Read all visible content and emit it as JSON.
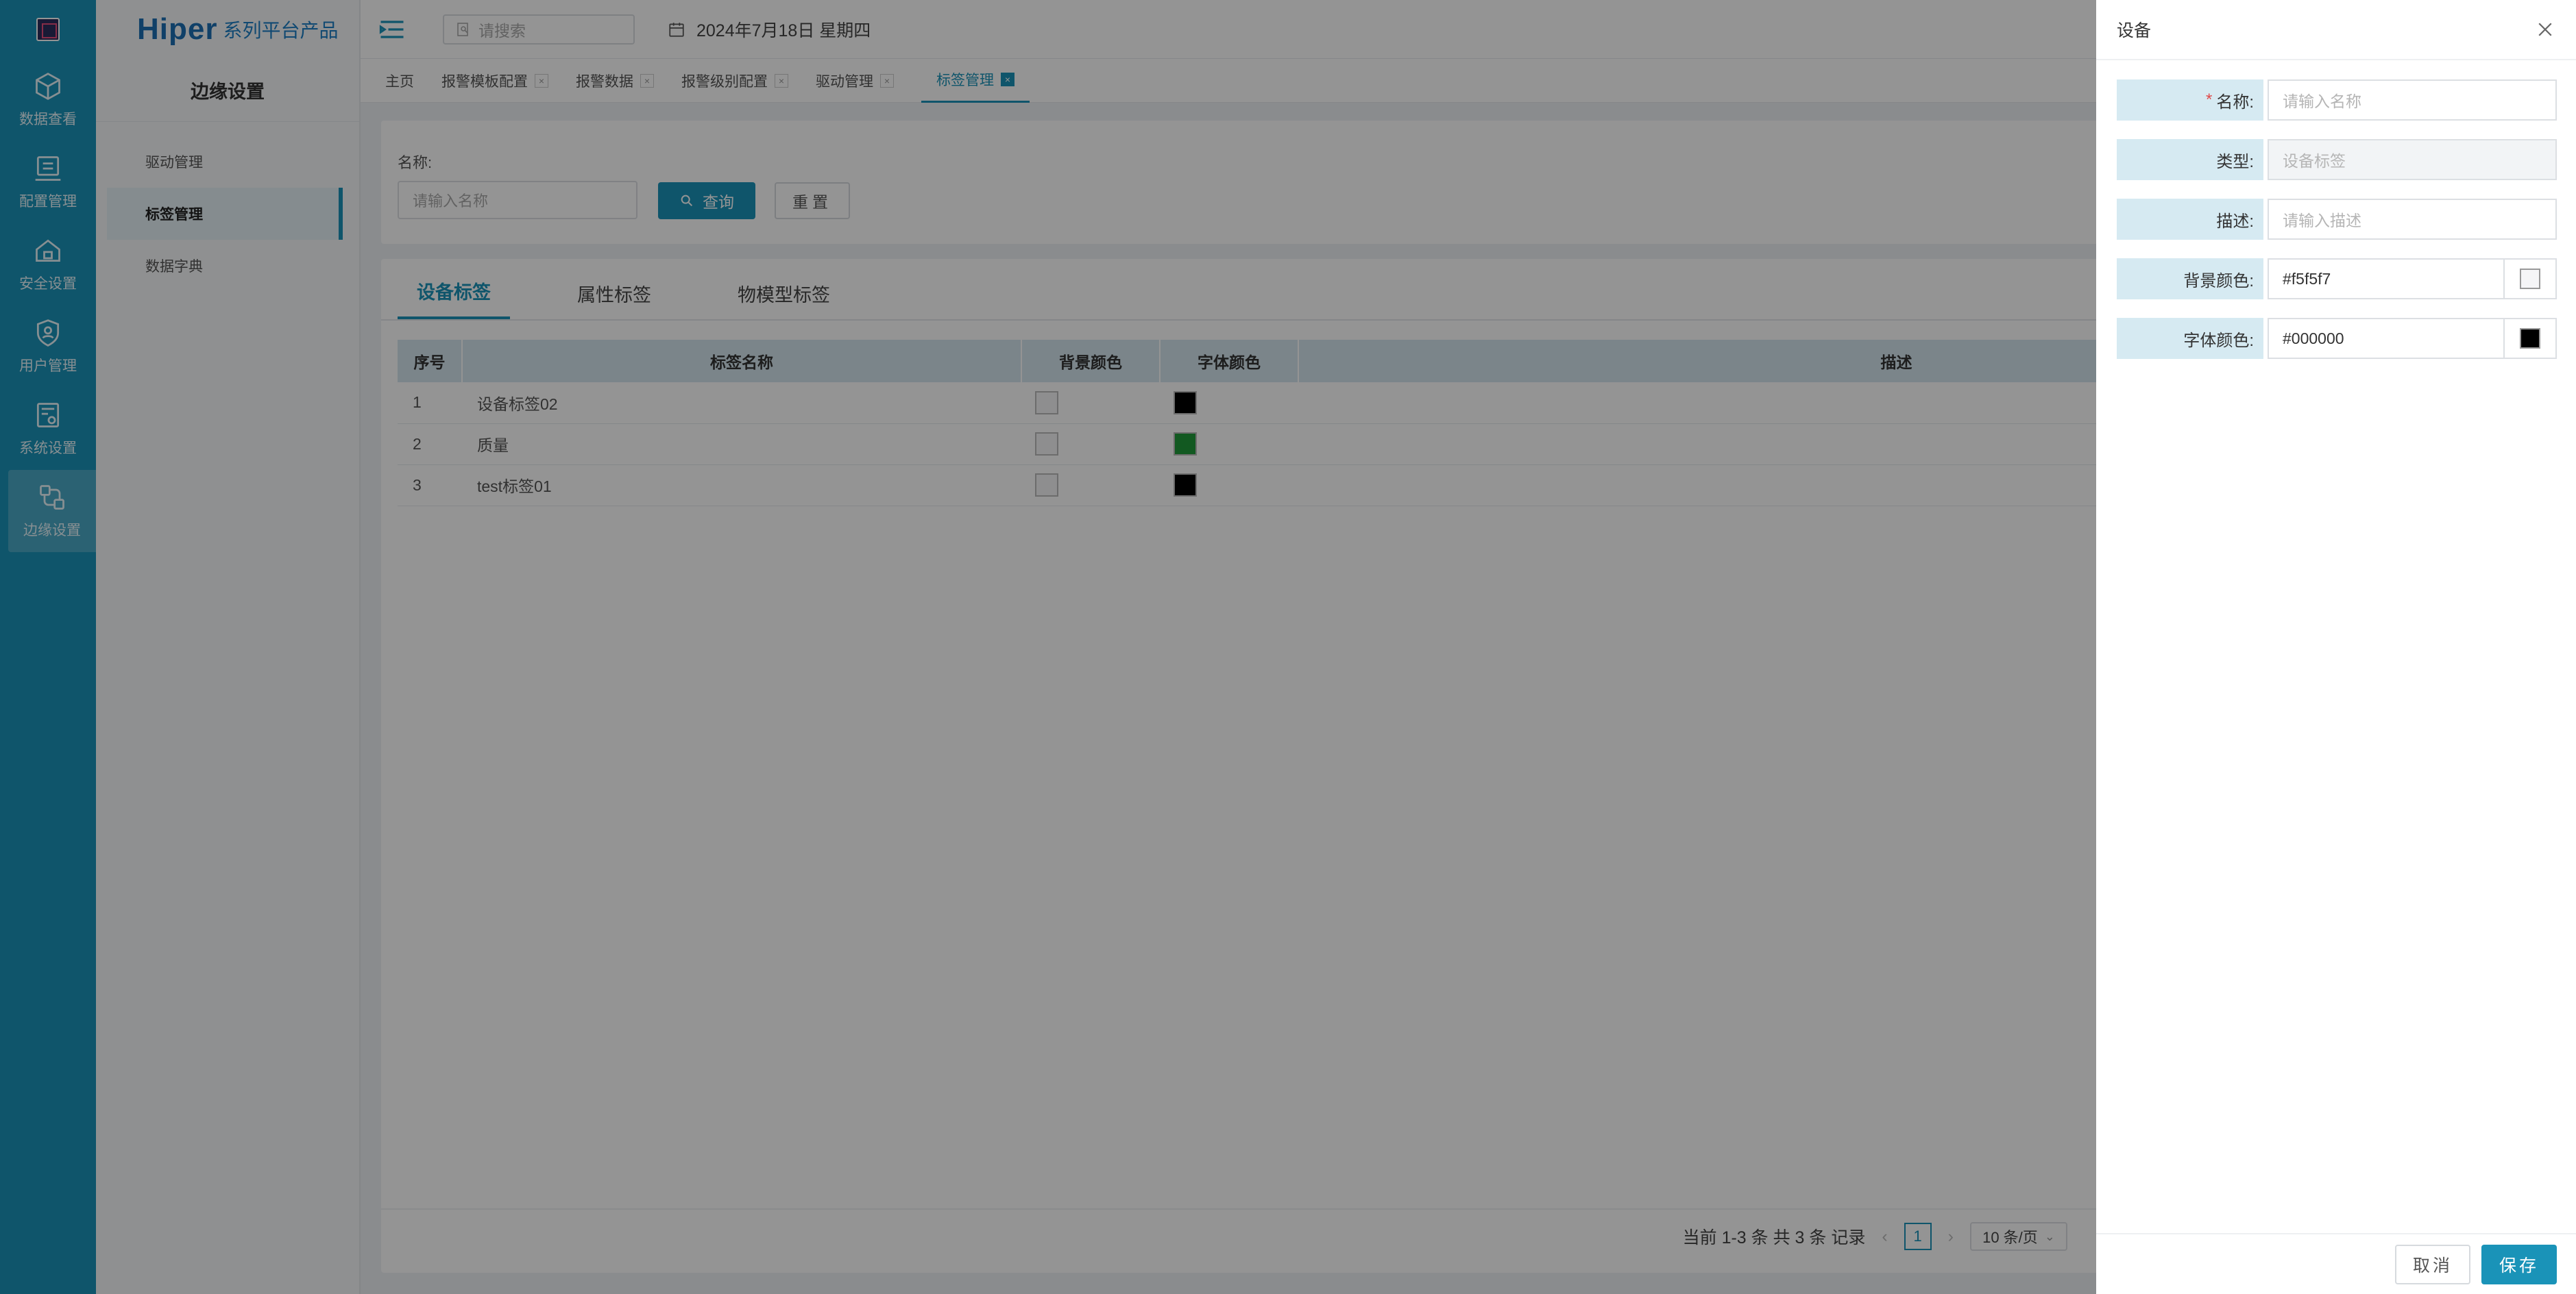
{
  "brand": {
    "name": "Hiper",
    "subtitle": "系列平台产品"
  },
  "rail": [
    {
      "label": "数据查看",
      "icon": "cube-icon"
    },
    {
      "label": "配置管理",
      "icon": "config-icon"
    },
    {
      "label": "安全设置",
      "icon": "security-icon"
    },
    {
      "label": "用户管理",
      "icon": "user-shield-icon"
    },
    {
      "label": "系统设置",
      "icon": "system-icon"
    },
    {
      "label": "边缘设置",
      "icon": "edge-icon",
      "active": true
    }
  ],
  "sidebar": {
    "title": "边缘设置",
    "items": [
      {
        "label": "驱动管理"
      },
      {
        "label": "标签管理",
        "active": true
      },
      {
        "label": "数据字典"
      }
    ]
  },
  "topbar": {
    "search_placeholder": "请搜索",
    "date": "2024年7月18日 星期四"
  },
  "tabs": [
    {
      "label": "主页",
      "closable": false
    },
    {
      "label": "报警模板配置",
      "closable": true
    },
    {
      "label": "报警数据",
      "closable": true
    },
    {
      "label": "报警级别配置",
      "closable": true
    },
    {
      "label": "驱动管理",
      "closable": true
    },
    {
      "label": "标签管理",
      "closable": true,
      "active": true
    }
  ],
  "query": {
    "name_label": "名称:",
    "name_placeholder": "请输入名称",
    "search_button": "查询",
    "reset_button": "重置"
  },
  "panel_tabs": [
    {
      "label": "设备标签",
      "active": true
    },
    {
      "label": "属性标签"
    },
    {
      "label": "物模型标签"
    }
  ],
  "table": {
    "columns": [
      "序号",
      "标签名称",
      "背景颜色",
      "字体颜色",
      "描述"
    ],
    "rows": [
      {
        "no": "1",
        "name": "设备标签02",
        "bg": "#f5f5f7",
        "fg": "#000000",
        "desc": ""
      },
      {
        "no": "2",
        "name": "质量",
        "bg": "#f5f5f7",
        "fg": "#1f9a3a",
        "desc": ""
      },
      {
        "no": "3",
        "name": "test标签01",
        "bg": "#f5f5f7",
        "fg": "#000000",
        "desc": ""
      }
    ]
  },
  "pager": {
    "summary": "当前 1-3 条 共 3 条 记录",
    "page": "1",
    "page_size": "10 条/页"
  },
  "drawer": {
    "title": "设备",
    "fields": [
      {
        "label": "名称:",
        "required": true,
        "placeholder": "请输入名称",
        "value": ""
      },
      {
        "label": "类型:",
        "required": false,
        "placeholder": "设备标签",
        "value": "",
        "disabled": true
      },
      {
        "label": "描述:",
        "required": false,
        "placeholder": "请输入描述",
        "value": ""
      },
      {
        "label": "背景颜色:",
        "required": false,
        "value": "#f5f5f7",
        "swatch": "#f5f5f7"
      },
      {
        "label": "字体颜色:",
        "required": false,
        "value": "#000000",
        "swatch": "#000000"
      }
    ],
    "cancel": "取消",
    "save": "保存"
  },
  "colors": {
    "primary": "#1a93b8",
    "rail": "#1a93b8",
    "header_row": "#d4e6ee",
    "label_bg": "#d6eaf2"
  }
}
